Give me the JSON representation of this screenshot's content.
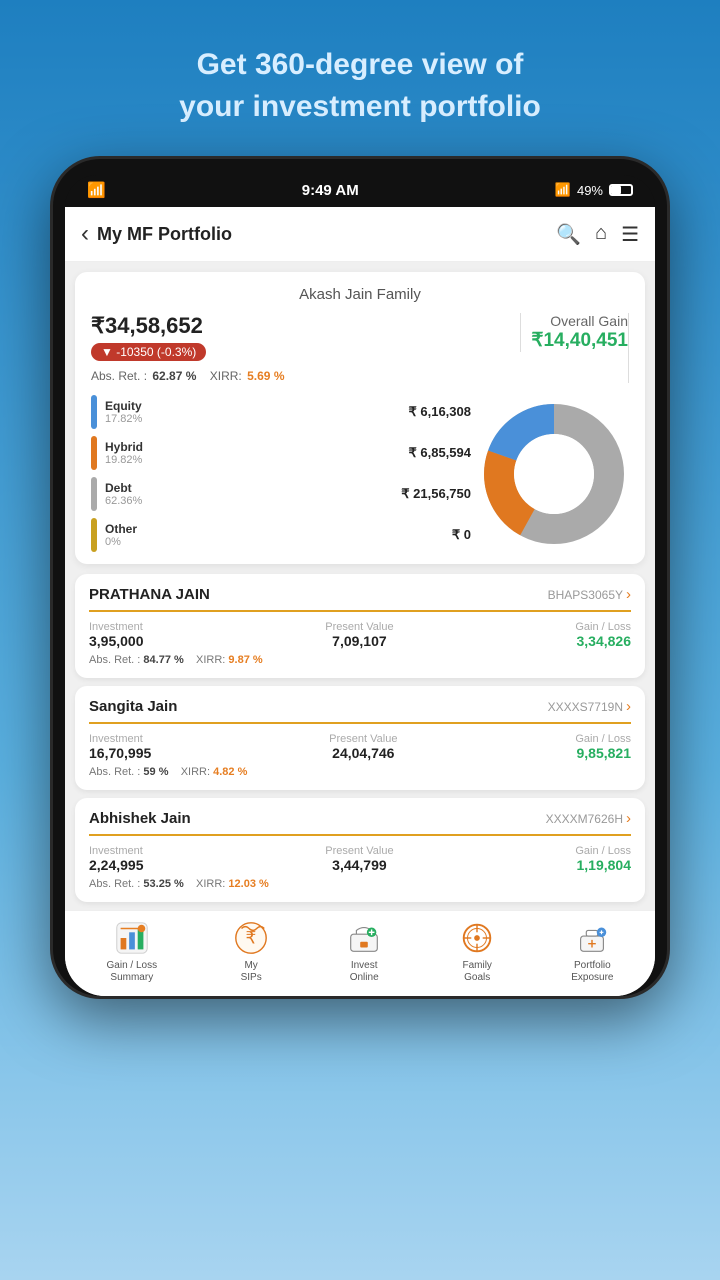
{
  "header": {
    "line1": "Get 360-degree view of",
    "line2": "your investment portfolio"
  },
  "status_bar": {
    "time": "9:49 AM",
    "battery": "49%",
    "bluetooth": "49%"
  },
  "nav": {
    "back_label": "‹",
    "title": "My MF Portfolio"
  },
  "portfolio": {
    "family_name": "Akash Jain Family",
    "total_value": "₹34,58,652",
    "change_amount": "▼ -10350",
    "change_pct": "(-0.3%)",
    "abs_ret_label": "Abs. Ret. :",
    "abs_ret_value": "62.87 %",
    "xirr_label": "XIRR:",
    "xirr_value": "5.69 %",
    "overall_gain_label": "Overall Gain",
    "overall_gain_value": "₹14,40,451",
    "assets": [
      {
        "name": "Equity",
        "pct": "17.82%",
        "amount": "₹ 6,16,308",
        "color": "#4a90d9"
      },
      {
        "name": "Hybrid",
        "pct": "19.82%",
        "amount": "₹ 6,85,594",
        "color": "#e07820"
      },
      {
        "name": "Debt",
        "pct": "62.36%",
        "amount": "₹ 21,56,750",
        "color": "#aaaaaa"
      },
      {
        "name": "Other",
        "pct": "0%",
        "amount": "₹ 0",
        "color": "#c8a020"
      }
    ],
    "donut": {
      "segments": [
        {
          "label": "Equity",
          "pct": 17.82,
          "color": "#4a90d9"
        },
        {
          "label": "Hybrid",
          "pct": 19.82,
          "color": "#e07820"
        },
        {
          "label": "Debt",
          "pct": 62.36,
          "color": "#aaaaaa"
        }
      ]
    }
  },
  "members": [
    {
      "name": "PRATHANA JAIN",
      "pan": "BHAPS3065Y",
      "investment_label": "Investment",
      "investment_value": "3,95,000",
      "present_label": "Present Value",
      "present_value": "7,09,107",
      "gain_label": "Gain / Loss",
      "gain_value": "3,34,826",
      "abs_ret_label": "Abs. Ret. :",
      "abs_ret_value": "84.77 %",
      "xirr_label": "XIRR:",
      "xirr_value": "9.87 %"
    },
    {
      "name": "Sangita Jain",
      "pan": "XXXXS7719N",
      "investment_label": "Investment",
      "investment_value": "16,70,995",
      "present_label": "Present Value",
      "present_value": "24,04,746",
      "gain_label": "Gain / Loss",
      "gain_value": "9,85,821",
      "abs_ret_label": "Abs. Ret. :",
      "abs_ret_value": "59 %",
      "xirr_label": "XIRR:",
      "xirr_value": "4.82 %"
    },
    {
      "name": "Abhishek Jain",
      "pan": "XXXXM7626H",
      "investment_label": "Investment",
      "investment_value": "2,24,995",
      "present_label": "Present Value",
      "present_value": "3,44,799",
      "gain_label": "Gain / Loss",
      "gain_value": "1,19,804",
      "abs_ret_label": "Abs. Ret. :",
      "abs_ret_value": "53.25 %",
      "xirr_label": "XIRR:",
      "xirr_value": "12.03 %"
    }
  ],
  "bottom_nav": [
    {
      "id": "gain-loss",
      "label": "Gain / Loss\nSummary",
      "icon": "chart"
    },
    {
      "id": "my-sips",
      "label": "My\nSIPs",
      "icon": "coin"
    },
    {
      "id": "invest",
      "label": "Invest\nOnline",
      "icon": "cart"
    },
    {
      "id": "family",
      "label": "Family\nGoals",
      "icon": "target"
    },
    {
      "id": "exposure",
      "label": "Portfolio\nExposure",
      "icon": "briefcase"
    }
  ]
}
